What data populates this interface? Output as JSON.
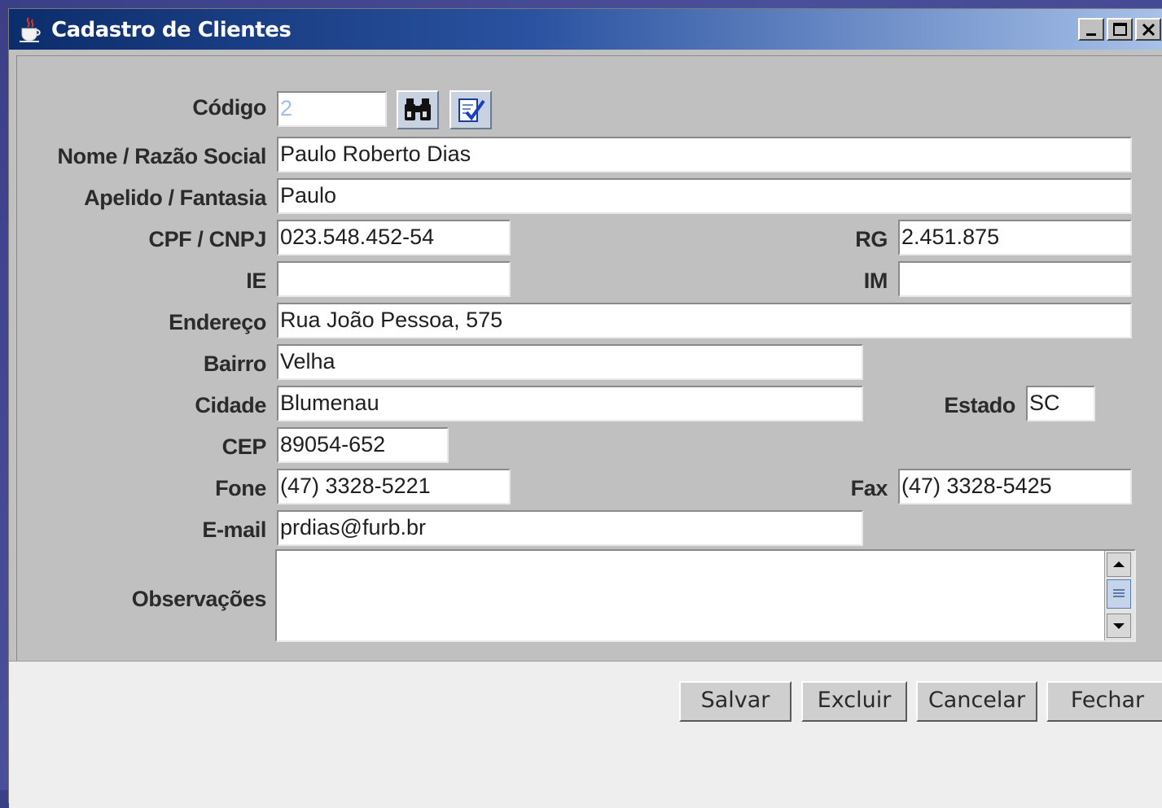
{
  "window": {
    "title": "Cadastro de Clientes"
  },
  "form": {
    "codigo": {
      "label": "Código",
      "value": "2"
    },
    "nome": {
      "label": "Nome / Razão Social",
      "value": "Paulo Roberto Dias"
    },
    "apelido": {
      "label": "Apelido / Fantasia",
      "value": "Paulo"
    },
    "cpf": {
      "label": "CPF / CNPJ",
      "value": "023.548.452-54"
    },
    "rg": {
      "label": "RG",
      "value": "2.451.875"
    },
    "ie": {
      "label": "IE",
      "value": ""
    },
    "im": {
      "label": "IM",
      "value": ""
    },
    "endereco": {
      "label": "Endereço",
      "value": "Rua João Pessoa, 575"
    },
    "bairro": {
      "label": "Bairro",
      "value": "Velha"
    },
    "cidade": {
      "label": "Cidade",
      "value": "Blumenau"
    },
    "estado": {
      "label": "Estado",
      "value": "SC"
    },
    "cep": {
      "label": "CEP",
      "value": "89054-652"
    },
    "fone": {
      "label": "Fone",
      "value": "(47) 3328-5221"
    },
    "fax": {
      "label": "Fax",
      "value": "(47) 3328-5425"
    },
    "email": {
      "label": "E-mail",
      "value": "prdias@furb.br"
    },
    "observacoes": {
      "label": "Observações",
      "value": ""
    }
  },
  "buttons": {
    "salvar": "Salvar",
    "excluir": "Excluir",
    "cancelar": "Cancelar",
    "fechar": "Fechar"
  },
  "icons": {
    "title": "java-coffee-cup-icon",
    "search": "binoculars-icon",
    "edit": "document-check-icon"
  }
}
